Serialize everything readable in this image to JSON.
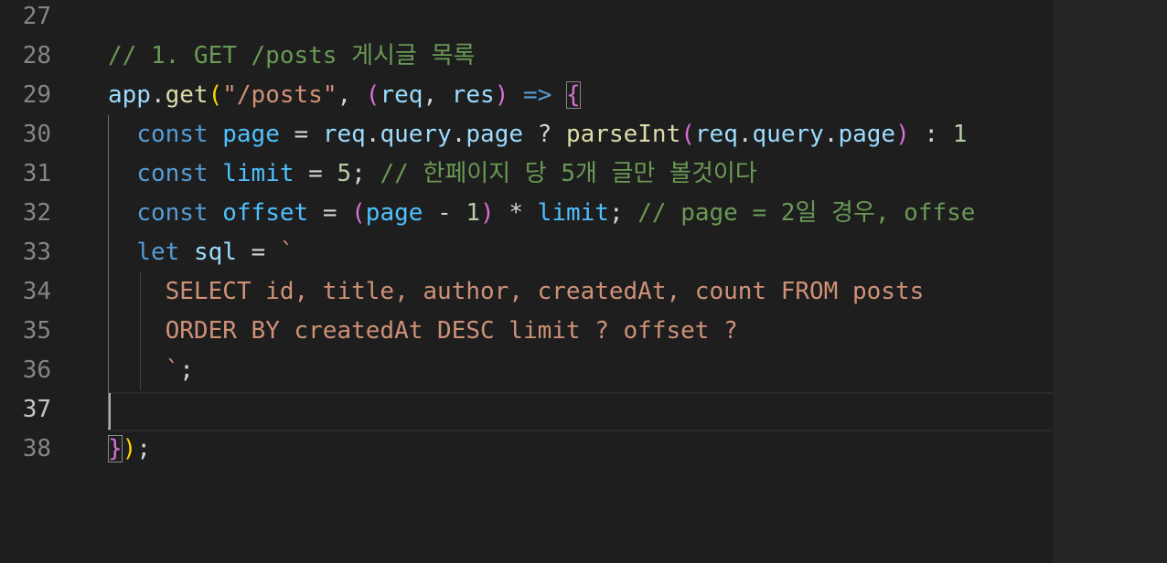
{
  "editor": {
    "active_line": "37",
    "colors": {
      "background": "#1e1e1e",
      "comment": "#6a9955",
      "keyword": "#569cd6",
      "function": "#dcdcaa",
      "string": "#ce9178",
      "variable": "#9cdcfe",
      "bracket_yellow": "#ffd700",
      "bracket_purple": "#da70d6"
    },
    "lines": [
      {
        "number": "27",
        "text": ""
      },
      {
        "number": "28",
        "text": "// 1. GET /posts 게시글 목록"
      },
      {
        "number": "29",
        "text": "app.get(\"/posts\", (req, res) => {"
      },
      {
        "number": "30",
        "text": "  const page = req.query.page ? parseInt(req.query.page) : 1"
      },
      {
        "number": "31",
        "text": "  const limit = 5; // 한페이지 당 5개 글만 볼것이다"
      },
      {
        "number": "32",
        "text": "  const offset = (page - 1) * limit; // page = 2일 경우, offse"
      },
      {
        "number": "33",
        "text": "  let sql = `"
      },
      {
        "number": "34",
        "text": "    SELECT id, title, author, createdAt, count FROM posts"
      },
      {
        "number": "35",
        "text": "    ORDER BY createdAt DESC limit ? offset ?"
      },
      {
        "number": "36",
        "text": "    `;"
      },
      {
        "number": "37",
        "text": ""
      },
      {
        "number": "38",
        "text": "});"
      }
    ],
    "tokens": {
      "l28_comment": "// 1. GET /posts 게시글 목록",
      "l29_app": "app",
      "l29_dot": ".",
      "l29_get": "get",
      "l29_paren_open": "(",
      "l29_string": "\"/posts\"",
      "l29_comma": ", ",
      "l29_paren2_open": "(",
      "l29_req": "req",
      "l29_comma2": ", ",
      "l29_res": "res",
      "l29_paren2_close": ")",
      "l29_arrow": " => ",
      "l29_brace": "{",
      "l30_const": "const",
      "l30_page": "page",
      "l30_eq": " = ",
      "l30_req": "req",
      "l30_dot1": ".",
      "l30_query": "query",
      "l30_dot2": ".",
      "l30_page2": "page",
      "l30_q": " ? ",
      "l30_parseint": "parseInt",
      "l30_paren_open": "(",
      "l30_req2": "req",
      "l30_dot3": ".",
      "l30_query2": "query",
      "l30_dot4": ".",
      "l30_page3": "page",
      "l30_paren_close": ")",
      "l30_colon": " : ",
      "l30_one": "1",
      "l31_const": "const",
      "l31_limit": "limit",
      "l31_eq": " = ",
      "l31_five": "5",
      "l31_semi": "; ",
      "l31_comment": "// 한페이지 당 5개 글만 볼것이다",
      "l32_const": "const",
      "l32_offset": "offset",
      "l32_eq": " = ",
      "l32_paren_open": "(",
      "l32_page": "page",
      "l32_minus": " - ",
      "l32_one": "1",
      "l32_paren_close": ")",
      "l32_mul": " * ",
      "l32_limit": "limit",
      "l32_semi": "; ",
      "l32_comment": "// page = 2일 경우, offse",
      "l33_let": "let",
      "l33_sql": "sql",
      "l33_eq": " = ",
      "l33_tick": "`",
      "l34_sql": "SELECT id, title, author, createdAt, count FROM posts",
      "l35_sql": "ORDER BY createdAt DESC limit ? offset ?",
      "l36_tick": "`",
      "l36_semi": ";",
      "l38_brace": "}",
      "l38_paren": ")",
      "l38_semi": ";"
    }
  }
}
